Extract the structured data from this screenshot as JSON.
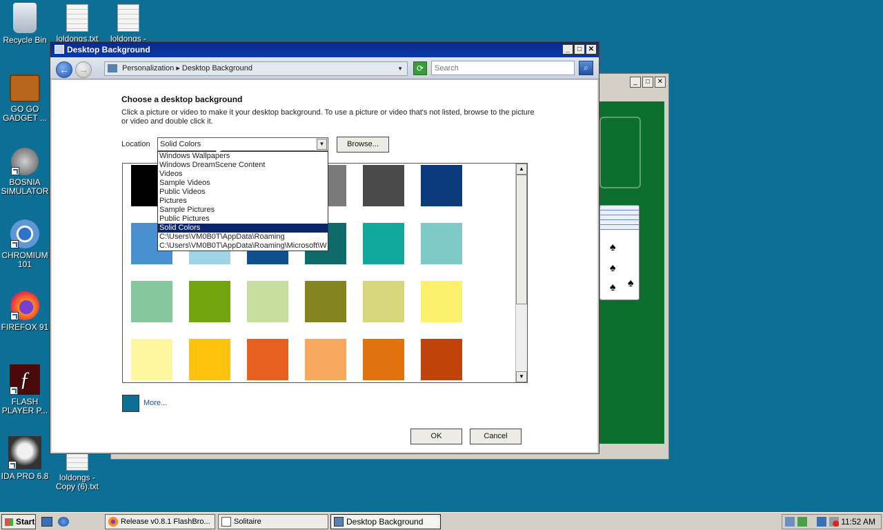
{
  "desktop": {
    "icons": [
      {
        "label": "Recycle Bin"
      },
      {
        "label": "loldongs.txt"
      },
      {
        "label": "loldongs -"
      },
      {
        "label": "GO GO GADGET ..."
      },
      {
        "label": "BOSNIA SIMULATOR"
      },
      {
        "label": "CHROMIUM 101"
      },
      {
        "label": "FIREFOX 91"
      },
      {
        "label": "FLASH PLAYER P..."
      },
      {
        "label": "IDA PRO 6.8"
      },
      {
        "label": "loldongs - Copy (6).txt"
      }
    ]
  },
  "window": {
    "title": "Desktop Background",
    "breadcrumb": "Personalization  ▸  Desktop Background",
    "search_placeholder": "Search",
    "heading": "Choose a desktop background",
    "description": "Click a picture or video to make it your desktop background. To use a picture or video that's not listed, browse to the picture or video and double click it.",
    "location_label": "Location",
    "location_value": "Solid Colors",
    "browse_label": "Browse...",
    "more_label": "More...",
    "ok_label": "OK",
    "cancel_label": "Cancel",
    "location_options": [
      "Windows Wallpapers",
      "Windows DreamScene Content",
      "Videos",
      "Sample Videos",
      "Public Videos",
      "Pictures",
      "Sample Pictures",
      "Public Pictures",
      "Solid Colors",
      "C:\\Users\\VM0B0T\\AppData\\Roaming",
      "C:\\Users\\VM0B0T\\AppData\\Roaming\\Microsoft\\W"
    ],
    "selected_option_index": 8
  },
  "swatches": [
    [
      "#000000",
      "#ffffff",
      "#ffffff",
      "#7a7a7a",
      "#4a4a4a",
      "#0b3b7a"
    ],
    [
      "#4a8fd0",
      "#9fd4e6",
      "#0f4f8f",
      "#0f6a6a",
      "#12a99c",
      "#7ecac8"
    ],
    [
      "#86c79e",
      "#72a40e",
      "#c5dea0",
      "#838420",
      "#d7d67a",
      "#fdf06a"
    ],
    [
      "#fff6a0",
      "#fec20f",
      "#e8601e",
      "#f9a95e",
      "#e2720e",
      "#c0440a"
    ]
  ],
  "taskbar": {
    "start_label": "Start",
    "tasks": [
      {
        "label": "Release v0.8.1 FlashBro..."
      },
      {
        "label": "Solitaire"
      },
      {
        "label": "Desktop Background"
      }
    ],
    "clock": "11:52 AM"
  },
  "colors": {
    "desktop": "#0e6f96",
    "titlebar": "#0b3aa6",
    "selection": "#0a246a"
  }
}
